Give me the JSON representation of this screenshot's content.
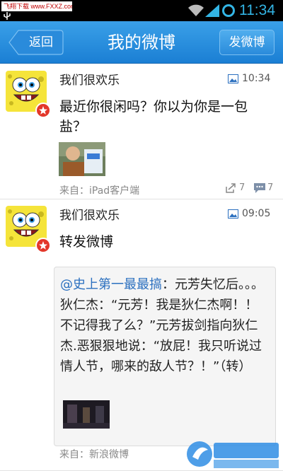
{
  "statusbar": {
    "watermark": "飞翔下载 www.FXXZ.com",
    "time": "11:34"
  },
  "header": {
    "back_label": "返回",
    "title": "我的微博",
    "compose_label": "发微博"
  },
  "posts": [
    {
      "username": "我们很欢乐",
      "time": "10:34",
      "content": "最近你很闲吗？你以为你是一包盐？",
      "source": "来自：iPad客户端",
      "reposts": "7",
      "comments": "7"
    },
    {
      "username": "我们很欢乐",
      "time": "09:05",
      "content": "转发微博",
      "retweet_mention": "@史上第一最最搞",
      "retweet_text": "：元芳失忆后。。。狄仁杰：“元芳！我是狄仁杰啊！！不记得我了么？”元芳拔剑指向狄仁杰.恶狠狠地说：“放屁！我只听说过情人节，哪来的敌人节？！”（转）",
      "source": "来自：新浪微博"
    }
  ],
  "watermark_logo": "飞翔下载 www.FXXZ.com",
  "colors": {
    "titlebar": "#1b7fd4",
    "clock": "#33b5e5",
    "mention": "#2a6fbf"
  }
}
